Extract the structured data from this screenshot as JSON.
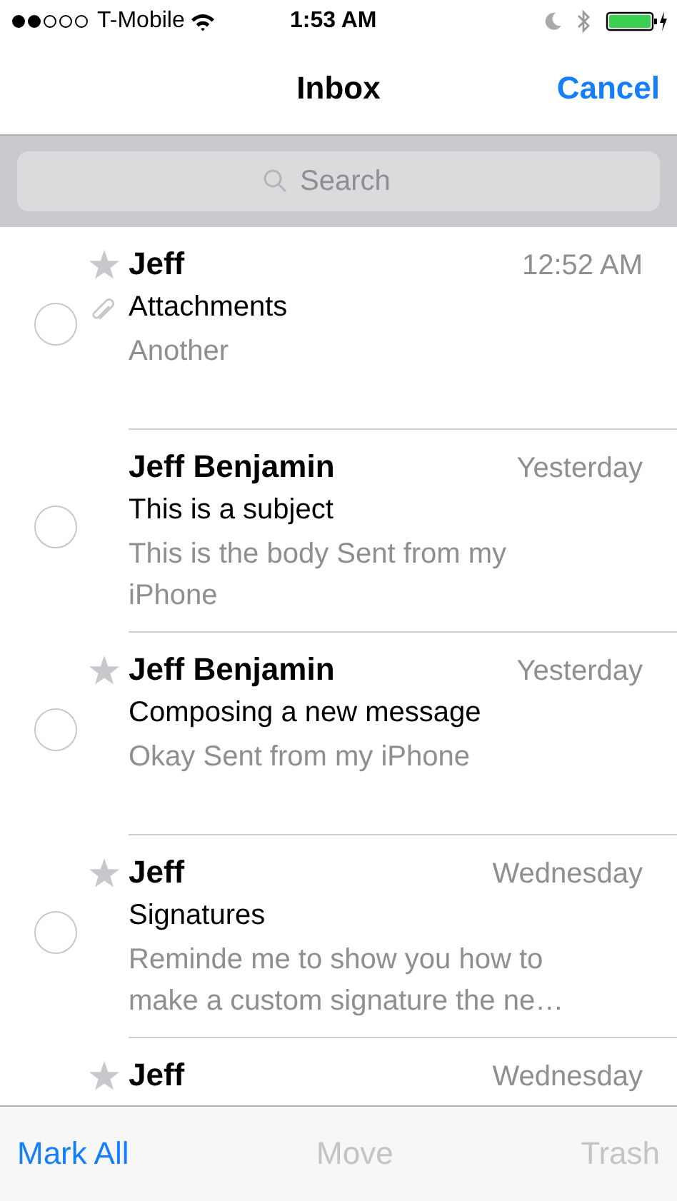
{
  "status_bar": {
    "carrier": "T-Mobile",
    "time": "1:53 AM"
  },
  "nav": {
    "title": "Inbox",
    "action": "Cancel"
  },
  "search": {
    "placeholder": "Search"
  },
  "messages": [
    {
      "sender": "Jeff",
      "date": "12:52 AM",
      "subject": "Attachments",
      "preview": "Another",
      "flagged": true,
      "attachment": true,
      "selected": false
    },
    {
      "sender": "Jeff Benjamin",
      "date": "Yesterday",
      "subject": "This is a subject",
      "preview": "This is the body Sent from my iPhone",
      "flagged": false,
      "attachment": false,
      "selected": false
    },
    {
      "sender": "Jeff Benjamin",
      "date": "Yesterday",
      "subject": "Composing a new message",
      "preview": "Okay Sent from my iPhone",
      "flagged": true,
      "attachment": false,
      "selected": false
    },
    {
      "sender": "Jeff",
      "date": "Wednesday",
      "subject": "Signatures",
      "preview": "Reminde me to show you how to make a custom signature the ne…",
      "flagged": true,
      "attachment": false,
      "selected": false
    },
    {
      "sender": "Jeff",
      "date": "Wednesday",
      "flagged": true
    }
  ],
  "toolbar": [
    {
      "label": "Mark All",
      "disabled": false
    },
    {
      "label": "Move",
      "disabled": true
    },
    {
      "label": "Trash",
      "disabled": true
    }
  ]
}
